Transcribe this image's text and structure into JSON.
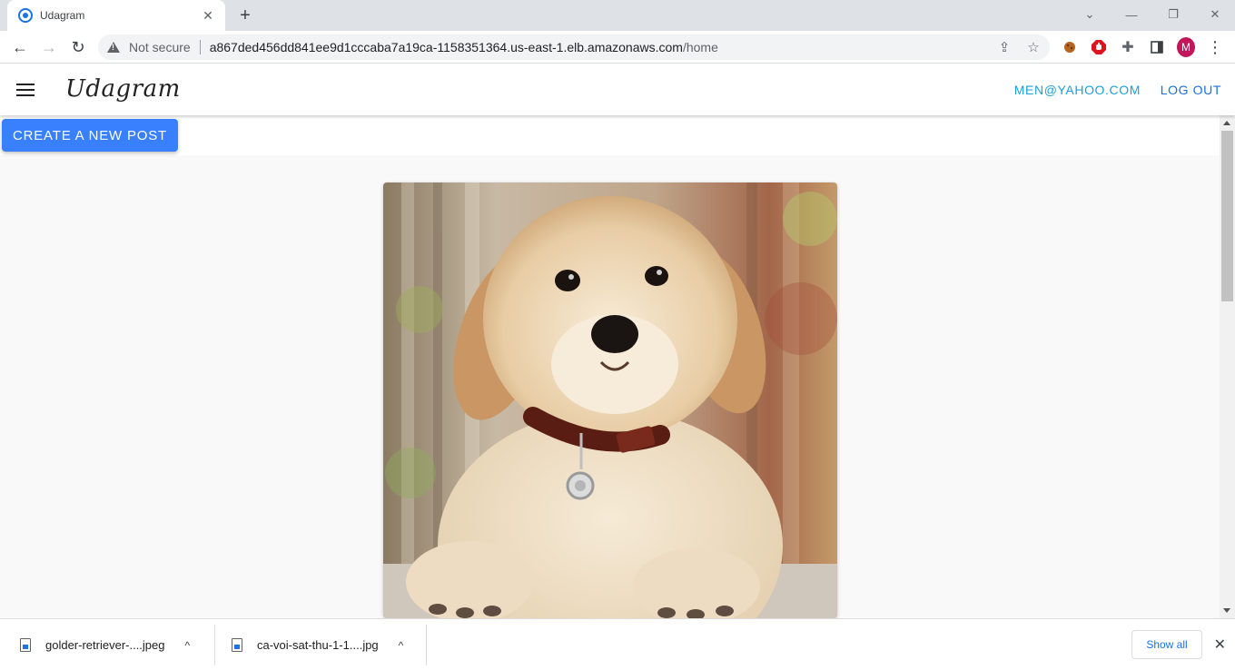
{
  "browser": {
    "tab": {
      "title": "Udagram",
      "favicon": "loading-circle-icon",
      "close": "✕"
    },
    "new_tab": "+",
    "window_controls": {
      "tab_search": "⌄",
      "minimize": "—",
      "restore": "❐",
      "close": "✕"
    },
    "nav": {
      "back": "←",
      "forward": "→",
      "reload": "↻"
    },
    "address": {
      "security_label": "Not secure",
      "host": "a867ded456dd841ee9d1cccaba7a19ca-1158351364.us-east-1.elb.amazonaws.com",
      "path": "/home"
    },
    "omnibox_icons": {
      "share": "⇪",
      "bookmark": "☆"
    },
    "extensions": {
      "puzzle": "✚",
      "sidebar": "▮",
      "menu": "⋮"
    },
    "profile_initial": "M"
  },
  "app": {
    "brand": "Udagram",
    "user_email": "MEN@YAHOO.COM",
    "logout_label": "LOG OUT",
    "create_post_label": "CREATE A NEW POST",
    "feed": [
      {
        "image_alt": "golden retriever puppy"
      }
    ]
  },
  "downloads": {
    "items": [
      {
        "name": "golder-retriever-....jpeg",
        "caret": "^"
      },
      {
        "name": "ca-voi-sat-thu-1-1....jpg",
        "caret": "^"
      }
    ],
    "show_all_label": "Show all",
    "close": "✕"
  },
  "colors": {
    "accent": "#3880ff",
    "email": "#1aa0d8",
    "logout": "#1a6fd8",
    "chrome_tabstrip": "#dee1e6"
  }
}
